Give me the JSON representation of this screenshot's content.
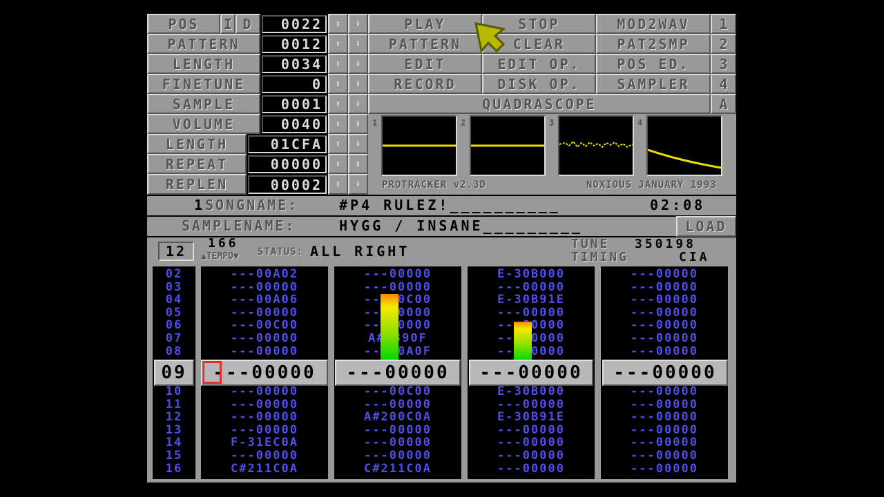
{
  "left_labels": {
    "pos": "POS",
    "insert": "I",
    "delete": "D",
    "pattern": "PATTERN",
    "length": "LENGTH",
    "finetune": "FINETUNE",
    "sample": "SAMPLE",
    "volume": "VOLUME",
    "sample_length": "LENGTH",
    "repeat": "REPEAT",
    "replen": "REPLEN"
  },
  "left_values": {
    "pos": "0022",
    "pattern": "0012",
    "length": "0034",
    "finetune": "0",
    "sample": "0001",
    "volume": "0040",
    "sample_length": "01CFA",
    "repeat": "00000",
    "replen": "00002"
  },
  "arrows": {
    "up": "⬆",
    "down": "⬇"
  },
  "menu": {
    "play": "PLAY",
    "stop": "STOP",
    "mod2wav": "MOD2WAV",
    "f1": "1",
    "pattern": "PATTERN",
    "clear": "CLEAR",
    "pat2smp": "PAT2SMP",
    "f2": "2",
    "edit": "EDIT",
    "edit_op": "EDIT OP.",
    "pos_ed": "POS ED.",
    "f3": "3",
    "record": "RECORD",
    "disk_op": "DISK OP.",
    "sampler": "SAMPLER",
    "f4": "4",
    "quadrascope": "QUADRASCOPE",
    "fa": "A"
  },
  "scopes": [
    "1",
    "2",
    "3",
    "4"
  ],
  "footer_left": "PROTRACKER v2.3D",
  "footer_right": "NOXIOUS JANUARY 1993",
  "song": {
    "number": "1",
    "label": "SONGNAME:",
    "name": "#P4 RULEZ!__________",
    "time": "02:08"
  },
  "samplename": {
    "label": "SAMPLENAME:",
    "name": "HYGG / INSANE_________",
    "load": "LOAD"
  },
  "status": {
    "octave": "12",
    "tempo_value": "166",
    "tempo_label": "▲TEMPO▼",
    "status_label": "STATUS:",
    "status_value": "ALL RIGHT",
    "tune_label": "TUNE",
    "tune_value": "350198",
    "timing_label": "TIMING",
    "timing_value": "CIA"
  },
  "vu_levels": [
    0,
    0.86,
    0.5,
    0
  ],
  "rows_above": [
    "02",
    "03",
    "04",
    "05",
    "06",
    "07",
    "08"
  ],
  "rows_below": [
    "10",
    "11",
    "12",
    "13",
    "14",
    "15",
    "16"
  ],
  "current_row": "09",
  "tracks": [
    {
      "above": [
        "---00A02",
        "---00000",
        "---00A06",
        "---00000",
        "---00C00",
        "---00000",
        "---00000"
      ],
      "current": "---00000",
      "below": [
        "---00000",
        "---00000",
        "---00000",
        "---00000",
        "F-31EC0A",
        "---00000",
        "C#211C0A"
      ]
    },
    {
      "above": [
        "---00000",
        "---00000",
        "---00C00",
        "---00000",
        "---00000",
        "A#2390F",
        "---00A0F"
      ],
      "current": "---00000",
      "below": [
        "---00C00",
        "---00000",
        "A#200C0A",
        "---00000",
        "---00000",
        "---00000",
        "C#211C0A"
      ]
    },
    {
      "above": [
        "E-30B000",
        "---00000",
        "E-30B91E",
        "---00000",
        "---00000",
        "---00000",
        "---00000"
      ],
      "current": "---00000",
      "below": [
        "E-30B000",
        "---00000",
        "E-30B91E",
        "---00000",
        "---00000",
        "---00000",
        "---00000"
      ]
    },
    {
      "above": [
        "---00000",
        "---00000",
        "---00000",
        "---00000",
        "---00000",
        "---00000",
        "---00000"
      ],
      "current": "---00000",
      "below": [
        "---00000",
        "---00000",
        "---00000",
        "---00000",
        "---00000",
        "---00000",
        "---00000"
      ]
    }
  ],
  "colors": {
    "panel": "#999999",
    "text_blue": "#4f4fe6",
    "scope_line": "#f0e000",
    "cursor": "#e03030"
  }
}
